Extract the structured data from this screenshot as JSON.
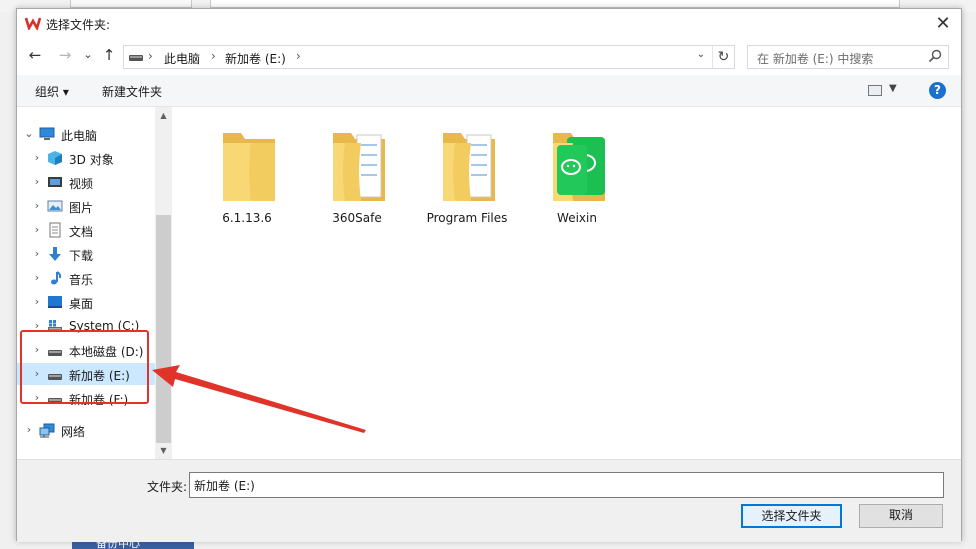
{
  "dialog": {
    "title": "选择文件夹:",
    "close_glyph": "✕"
  },
  "nav": {
    "back": "←",
    "forward": "→",
    "recent": "⌄",
    "up": "↑",
    "breadcrumb": [
      "此电脑",
      "新加卷 (E:)"
    ],
    "search_placeholder": "在 新加卷 (E:) 中搜索"
  },
  "toolbar": {
    "organize": "组织 ▾",
    "new_folder": "新建文件夹",
    "help": "?"
  },
  "tree": [
    {
      "label": "此电脑",
      "icon": "pc-icon",
      "arrow": "⌄",
      "selected": false
    },
    {
      "label": "3D 对象",
      "icon": "3d-objects-icon",
      "arrow": "›",
      "selected": false
    },
    {
      "label": "视频",
      "icon": "video-icon",
      "arrow": "›",
      "selected": false
    },
    {
      "label": "图片",
      "icon": "pictures-icon",
      "arrow": "›",
      "selected": false
    },
    {
      "label": "文档",
      "icon": "documents-icon",
      "arrow": "›",
      "selected": false
    },
    {
      "label": "下载",
      "icon": "downloads-icon",
      "arrow": "›",
      "selected": false
    },
    {
      "label": "音乐",
      "icon": "music-icon",
      "arrow": "›",
      "selected": false
    },
    {
      "label": "桌面",
      "icon": "desktop-icon",
      "arrow": "›",
      "selected": false
    },
    {
      "label": "System (C:)",
      "icon": "system-drive-icon",
      "arrow": "›",
      "selected": false
    },
    {
      "label": "本地磁盘 (D:)",
      "icon": "drive-icon",
      "arrow": "›",
      "selected": false
    },
    {
      "label": "新加卷 (E:)",
      "icon": "drive-icon",
      "arrow": "›",
      "selected": true
    },
    {
      "label": "新加卷 (F:)",
      "icon": "drive-icon",
      "arrow": "›",
      "selected": false
    },
    {
      "label": "网络",
      "icon": "network-icon",
      "arrow": "›",
      "selected": false
    }
  ],
  "folders": [
    {
      "name": "6.1.13.6",
      "icon": "folder-icon"
    },
    {
      "name": "360Safe",
      "icon": "folder-with-files-icon"
    },
    {
      "name": "Program Files",
      "icon": "folder-with-files-icon"
    },
    {
      "name": "Weixin",
      "icon": "wechat-folder-icon"
    }
  ],
  "footer": {
    "folder_label": "文件夹:",
    "folder_value": "新加卷 (E:)",
    "select_button": "选择文件夹",
    "cancel_button": "取消"
  },
  "background": {
    "bottom_tab": "备份中心"
  },
  "colors": {
    "annotation": "#e0342a",
    "selection": "#cce8ff",
    "accent": "#0078d7"
  }
}
